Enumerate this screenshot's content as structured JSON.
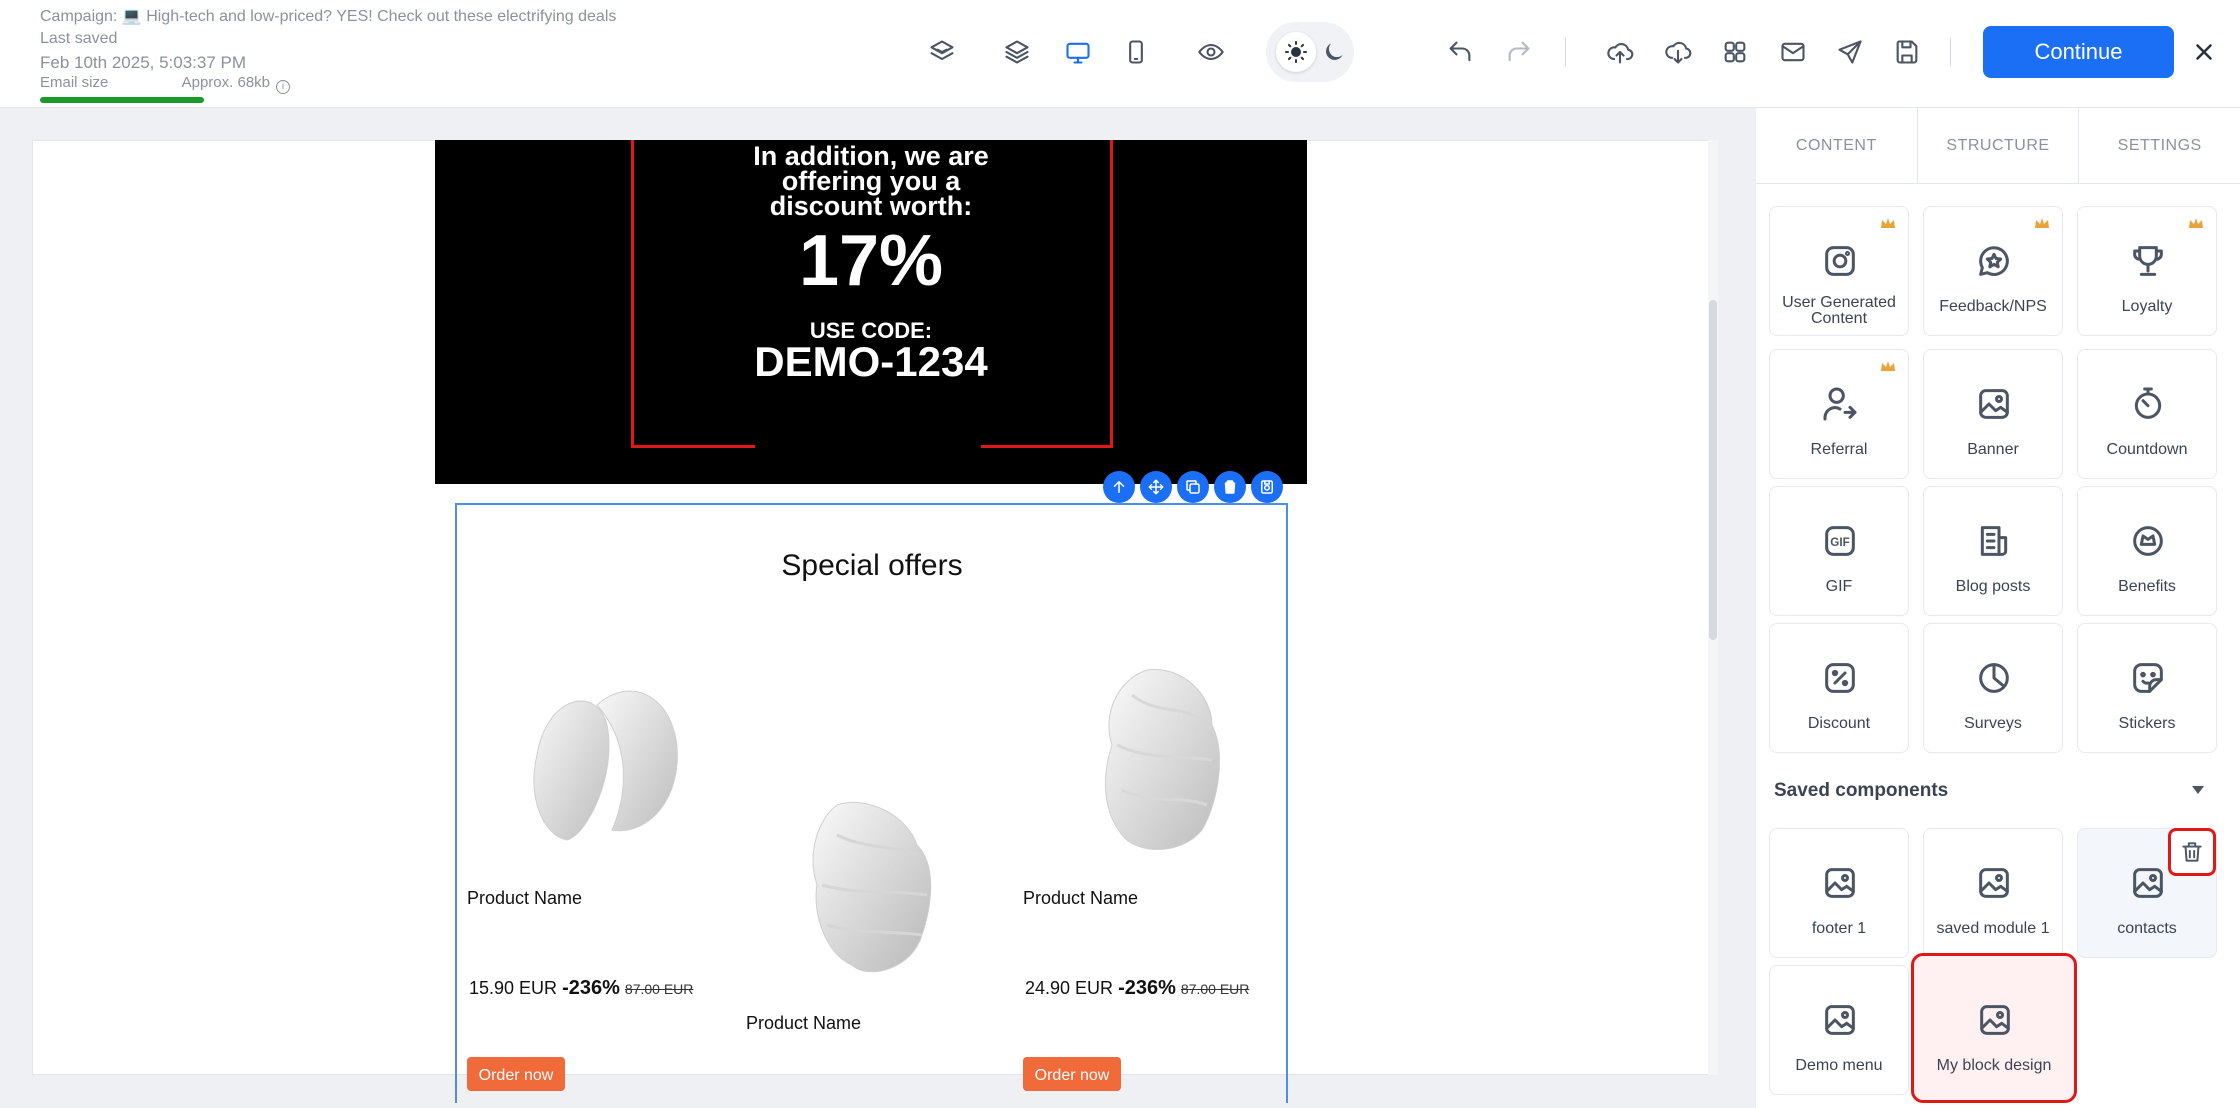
{
  "header": {
    "campaign": "Campaign: 💻 High-tech and low-priced? YES! Check out these electrifying deals",
    "last_saved_label": "Last saved",
    "last_saved_date": "Feb 10th 2025, 5:03:37 PM",
    "email_size_label": "Email size",
    "email_size_value": "Approx. 68kb",
    "continue_label": "Continue"
  },
  "email": {
    "discount_text": "In addition, we are offering you a discount worth:",
    "discount_value": "17%",
    "use_code_label": "USE CODE:",
    "code": "DEMO-1234",
    "offers_title": "Special offers",
    "products": [
      {
        "name": "Product Name",
        "price": "15.90 EUR",
        "discount": "-236%",
        "old_price": "87.00 EUR",
        "order_label": "Order now"
      },
      {
        "name": "Product Name"
      },
      {
        "name": "Product Name",
        "price": "24.90 EUR",
        "discount": "-236%",
        "old_price": "87.00 EUR",
        "order_label": "Order now"
      }
    ]
  },
  "sidebar": {
    "tabs": [
      "CONTENT",
      "STRUCTURE",
      "SETTINGS"
    ],
    "blocks": [
      {
        "label": "User Generated Content",
        "icon": "instagram-icon",
        "premium": true
      },
      {
        "label": "Feedback/NPS",
        "icon": "feedback-icon",
        "premium": true
      },
      {
        "label": "Loyalty",
        "icon": "trophy-icon",
        "premium": true
      },
      {
        "label": "Referral",
        "icon": "referral-icon",
        "premium": true
      },
      {
        "label": "Banner",
        "icon": "image-icon"
      },
      {
        "label": "Countdown",
        "icon": "timer-icon"
      },
      {
        "label": "GIF",
        "icon": "gif-icon"
      },
      {
        "label": "Blog posts",
        "icon": "blog-icon"
      },
      {
        "label": "Benefits",
        "icon": "benefits-icon"
      },
      {
        "label": "Discount",
        "icon": "discount-icon"
      },
      {
        "label": "Surveys",
        "icon": "pie-icon"
      },
      {
        "label": "Stickers",
        "icon": "sticker-icon"
      }
    ],
    "saved_title": "Saved components",
    "saved": [
      {
        "label": "footer 1"
      },
      {
        "label": "saved module 1"
      },
      {
        "label": "contacts"
      },
      {
        "label": "Demo menu"
      },
      {
        "label": "My block design"
      }
    ]
  }
}
